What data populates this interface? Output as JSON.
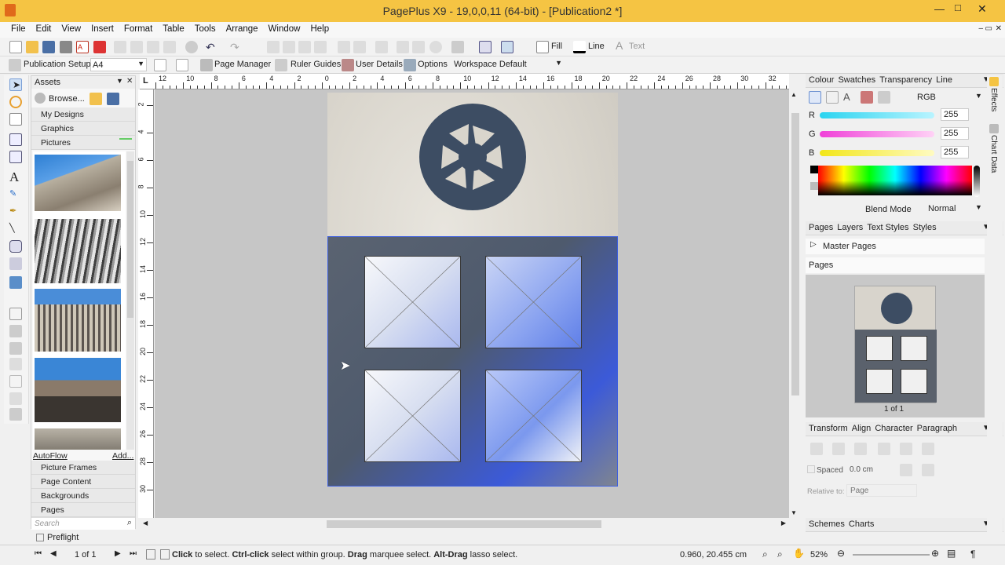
{
  "window": {
    "title": "PagePlus X9 - 19,0,0,11 (64-bit) - [Publication2 *]"
  },
  "menu": [
    "File",
    "Edit",
    "View",
    "Insert",
    "Format",
    "Table",
    "Tools",
    "Arrange",
    "Window",
    "Help"
  ],
  "toolbar1": {
    "fill_label": "Fill",
    "line_label": "Line",
    "text_label": "Text"
  },
  "toolbar2": {
    "publication_setup": "Publication Setup",
    "page_size": "A4",
    "page_manager": "Page Manager",
    "ruler_guides": "Ruler Guides",
    "user_details": "User Details",
    "options": "Options",
    "workspace": "Workspace Default"
  },
  "assets": {
    "title": "Assets",
    "browse": "Browse...",
    "categories": [
      "My Designs",
      "Graphics",
      "Pictures"
    ],
    "autoflow": "AutoFlow",
    "add": "Add...",
    "bottom_categories": [
      "Picture Frames",
      "Page Content",
      "Backgrounds",
      "Pages"
    ],
    "search_placeholder": "Search"
  },
  "rulers": {
    "horizontal": [
      "12",
      "10",
      "8",
      "6",
      "4",
      "2",
      "0",
      "2",
      "4",
      "6",
      "8",
      "10",
      "12",
      "14",
      "16",
      "18",
      "20",
      "22",
      "24",
      "26",
      "28",
      "30",
      "32"
    ],
    "vertical": [
      "2",
      "4",
      "6",
      "8",
      "10",
      "12",
      "14",
      "16",
      "18",
      "20",
      "22",
      "24",
      "26",
      "28",
      "30"
    ]
  },
  "colour_panel": {
    "tabs": [
      "Colour",
      "Swatches",
      "Transparency",
      "Line"
    ],
    "model": "RGB",
    "r_label": "R",
    "g_label": "G",
    "b_label": "B",
    "r": "255",
    "g": "255",
    "b": "255",
    "blend_label": "Blend Mode",
    "blend_value": "Normal"
  },
  "pages_panel": {
    "tabs": [
      "Pages",
      "Layers",
      "Text Styles",
      "Styles"
    ],
    "master_pages": "Master Pages",
    "pages": "Pages",
    "page_count": "1 of 1"
  },
  "transform_panel": {
    "tabs": [
      "Transform",
      "Align",
      "Character",
      "Paragraph"
    ],
    "spaced": "Spaced",
    "spaced_value": "0.0 cm",
    "relative_label": "Relative to:",
    "relative_value": "Page"
  },
  "schemes_panel": {
    "tabs": [
      "Schemes",
      "Charts"
    ]
  },
  "side_tabs": [
    "Effects",
    "Chart Data"
  ],
  "preflight": "Preflight",
  "status": {
    "page": "1 of 1",
    "hint_parts": [
      [
        "Click",
        "b"
      ],
      [
        " to select. ",
        ""
      ],
      [
        "Ctrl-click",
        "b"
      ],
      [
        " select within group. ",
        ""
      ],
      [
        "Drag",
        "b"
      ],
      [
        " marquee select. ",
        ""
      ],
      [
        "Alt-Drag",
        "b"
      ],
      [
        " lasso select.",
        ""
      ]
    ],
    "coords": "0.960, 20.455 cm",
    "zoom": "52%"
  },
  "colors": {
    "title_bar": "#f5c443",
    "accent_blue": "#3d5fe0",
    "logo": "#3d4d63"
  }
}
